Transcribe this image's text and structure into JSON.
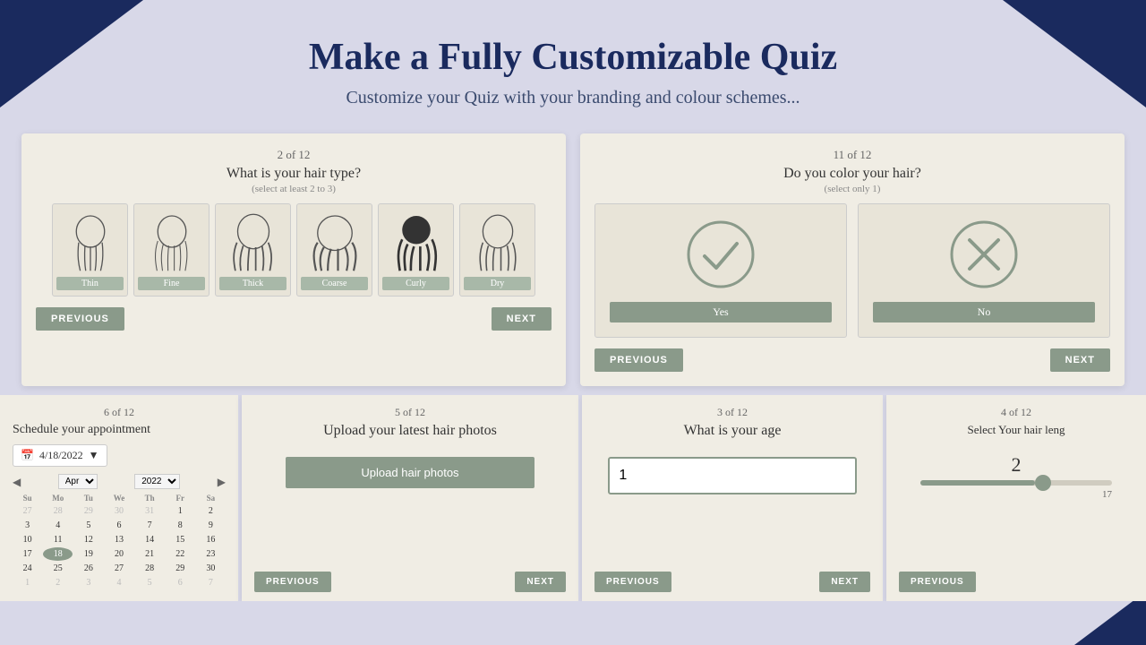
{
  "header": {
    "title": "Make a Fully Customizable Quiz",
    "subtitle": "Customize your Quiz with your branding and colour schemes..."
  },
  "card1": {
    "counter": "2 of 12",
    "question": "What is your hair type?",
    "instruction": "(select at least 2 to 3)",
    "options": [
      "Thin",
      "Fine",
      "Thick",
      "Coarse",
      "Curly",
      "Dry"
    ],
    "prev_label": "PREVIOUS",
    "next_label": "NEXT"
  },
  "card2": {
    "counter": "11 of 12",
    "question": "Do you color your hair?",
    "instruction": "(select only 1)",
    "yes_label": "Yes",
    "no_label": "No",
    "prev_label": "PREVIOUS",
    "next_label": "NEXT"
  },
  "card3": {
    "counter": "6 of 12",
    "question": "Schedule your appointment",
    "date_value": "4/18/2022",
    "month": "Apr",
    "year": "2022",
    "days_header": [
      "Su",
      "Mo",
      "Tu",
      "We",
      "Th",
      "Fr",
      "Sa"
    ],
    "weeks": [
      [
        "27",
        "28",
        "29",
        "30",
        "31",
        "1",
        "2"
      ],
      [
        "3",
        "4",
        "5",
        "6",
        "7",
        "8",
        "9"
      ],
      [
        "10",
        "11",
        "12",
        "13",
        "14",
        "15",
        "16"
      ],
      [
        "17",
        "18",
        "19",
        "20",
        "21",
        "22",
        "23"
      ],
      [
        "24",
        "25",
        "26",
        "27",
        "28",
        "29",
        "30"
      ],
      [
        "1",
        "2",
        "3",
        "4",
        "5",
        "6",
        "7"
      ]
    ],
    "today_day": "18",
    "prev_label": "PREVIOUS",
    "next_label": "NEXT"
  },
  "card4": {
    "counter": "5 of 12",
    "question": "Upload your latest hair photos",
    "upload_label": "Upload hair photos",
    "prev_label": "PREVIOUS",
    "next_label": "NEXT"
  },
  "card5": {
    "counter": "3 of 12",
    "question": "What is your age",
    "input_value": "1",
    "prev_label": "PREVIOUS",
    "next_label": "NEXT"
  },
  "card6": {
    "counter": "4 of 12",
    "question": "Select Your hair leng",
    "slider_value": "2",
    "slider_max": "17",
    "prev_label": "PREVIOUS"
  }
}
